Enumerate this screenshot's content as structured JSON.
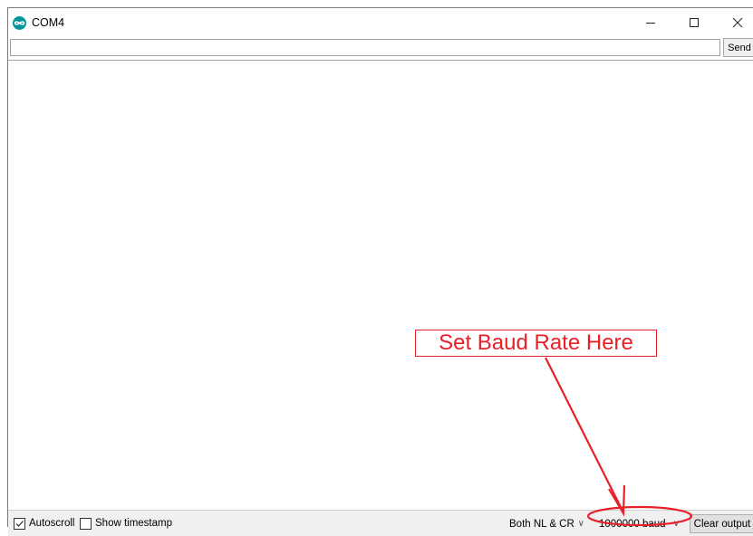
{
  "window": {
    "title": "COM4",
    "icon": "arduino-infinity-icon",
    "controls": [
      "minimize-icon",
      "maximize-icon",
      "close-icon"
    ]
  },
  "input": {
    "value": "",
    "send_label": "Send"
  },
  "output": {
    "text": ""
  },
  "statusbar": {
    "autoscroll_label": "Autoscroll",
    "autoscroll_checked": true,
    "timestamp_label": "Show timestamp",
    "timestamp_checked": false,
    "line_ending": "Both NL & CR",
    "baud_rate": "1000000 baud",
    "clear_label": "Clear output"
  },
  "annotation": {
    "text": "Set Baud Rate Here",
    "color": "#e8202a"
  },
  "colors": {
    "arduino_teal": "#00979c",
    "annotation_red": "#e8202a"
  }
}
